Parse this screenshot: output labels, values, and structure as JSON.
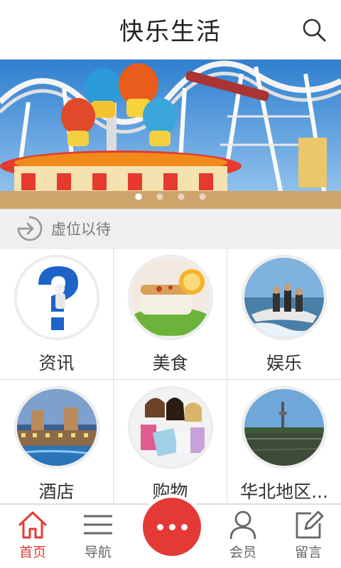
{
  "header": {
    "title": "快乐生活",
    "search_icon": "search-icon"
  },
  "banner": {
    "image": "amusement-park-carousel-rollercoaster",
    "slide_count": 4,
    "active_slide": 1
  },
  "notice": {
    "icon": "login-arrow-icon",
    "text": "虚位以待"
  },
  "categories": [
    {
      "label": "资讯",
      "image": "question-mark-figure"
    },
    {
      "label": "美食",
      "image": "grilled-fish-dish"
    },
    {
      "label": "娱乐",
      "image": "jet-ski"
    },
    {
      "label": "酒店",
      "image": "resort-pool"
    },
    {
      "label": "购物",
      "image": "shopping-women"
    },
    {
      "label": "华北地区...",
      "image": "lake-tower"
    }
  ],
  "tabbar": {
    "home": "首页",
    "nav": "导航",
    "member": "会员",
    "message": "留言",
    "active_tab": "home",
    "accent": "#e53935"
  }
}
